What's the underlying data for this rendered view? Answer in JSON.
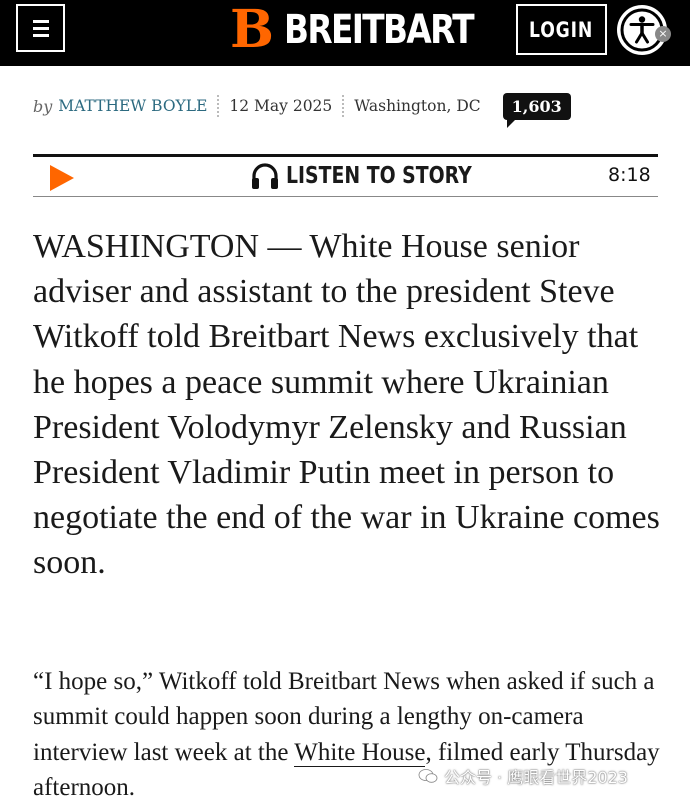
{
  "header": {
    "logo_mark": "B",
    "logo_text": "BREITBART",
    "login_label": "LOGIN",
    "menu_icon": "hamburger-menu-icon",
    "accessibility_icon": "accessibility-icon",
    "accessibility_close": "×"
  },
  "byline": {
    "by": "by",
    "author": "MATTHEW BOYLE",
    "date": "12 May 2025",
    "location": "Washington, DC",
    "comment_count": "1,603"
  },
  "listen": {
    "label": "LISTEN TO STORY",
    "duration": "8:18",
    "play_icon": "play-icon",
    "headphones_icon": "headphones-icon"
  },
  "article": {
    "lead": "WASHINGTON — White House senior adviser and assistant to the president Steve Witkoff told Breitbart News exclusively that he hopes a peace summit where Ukrainian President Volodymyr Zelensky and Russian President Vladimir Putin meet in person to negotiate the end of the war in Ukraine comes soon.",
    "para_before_link": "“I hope so,” Witkoff told Breitbart News when asked if such a summit could happen soon during a lengthy on-camera interview last week at the ",
    "para_link": "White House",
    "para_after_link": ", filmed early Thursday afternoon."
  },
  "watermark": {
    "text": "公众号 · 鹰眼看世界2023"
  },
  "colors": {
    "brand_orange": "#ff6600",
    "author_teal": "#2c6a80",
    "header_bg": "#000000"
  }
}
